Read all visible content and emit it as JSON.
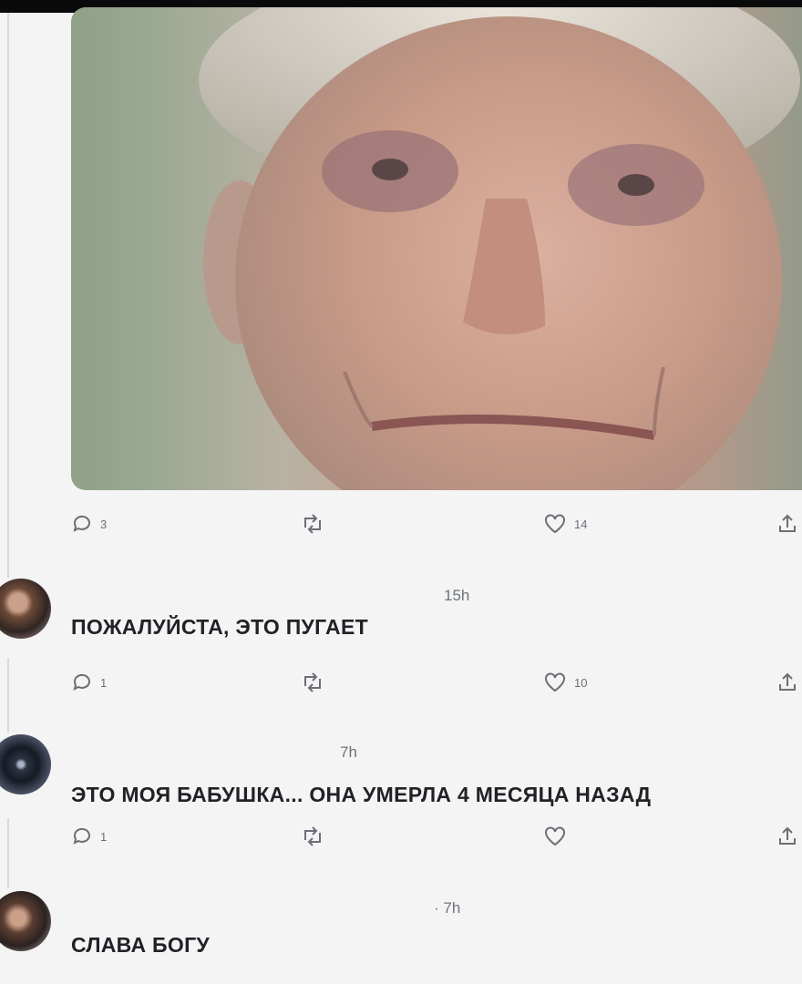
{
  "post": {
    "image_alt": "photo of an elderly woman's face",
    "actions": {
      "replies": "3",
      "likes": "14"
    }
  },
  "comments": [
    {
      "time": "15h",
      "text": "ПОЖАЛУЙСТА, ЭТО ПУГАЕТ",
      "replies": "1",
      "likes": "10"
    },
    {
      "time": "7h",
      "text": "ЭТО МОЯ БАБУШКА... ОНА УМЕРЛА 4 МЕСЯЦА НАЗАД",
      "replies": "1",
      "likes": ""
    },
    {
      "time": "· 7h",
      "text": "СЛАВА БОГУ"
    }
  ],
  "icons": {
    "reply": "speech-bubble-icon",
    "retweet": "retweet-icon",
    "like": "heart-icon",
    "share": "share-icon"
  },
  "colors": {
    "text": "#202226",
    "muted": "#6f7379",
    "background": "#f4f4f5"
  }
}
